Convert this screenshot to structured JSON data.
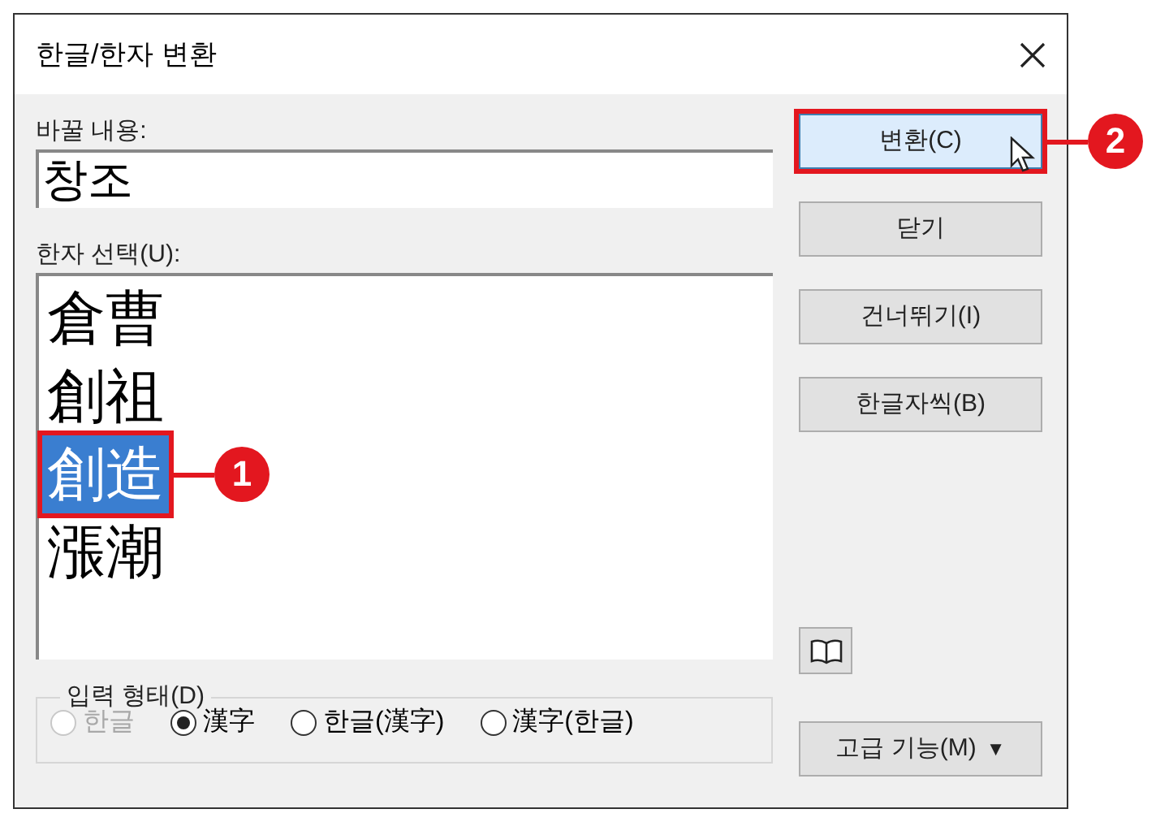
{
  "window": {
    "title": "한글/한자 변환"
  },
  "replace": {
    "label": "바꿀 내용:",
    "value": "창조"
  },
  "hanja": {
    "label": "한자 선택(U):",
    "items": [
      {
        "text": "倉曹",
        "selected": false
      },
      {
        "text": "創祖",
        "selected": false
      },
      {
        "text": "創造",
        "selected": true,
        "callout": "1"
      },
      {
        "text": "漲潮",
        "selected": false
      }
    ]
  },
  "input_form": {
    "label": "입력 형태(D)",
    "options": [
      {
        "label": "한글",
        "selected": false,
        "disabled": true
      },
      {
        "label": "漢字",
        "selected": true,
        "disabled": false
      },
      {
        "label": "한글(漢字)",
        "selected": false,
        "disabled": false
      },
      {
        "label": "漢字(한글)",
        "selected": false,
        "disabled": false
      }
    ]
  },
  "buttons": [
    {
      "label": "변환(C)",
      "hovered": true,
      "callout": "2"
    },
    {
      "label": "닫기",
      "hovered": false
    },
    {
      "label": "건너뛰기(I)",
      "hovered": false
    },
    {
      "label": "한글자씩(B)",
      "hovered": false
    }
  ],
  "advanced_button": {
    "label": "고급 기능(M)",
    "arrow": "▼"
  }
}
